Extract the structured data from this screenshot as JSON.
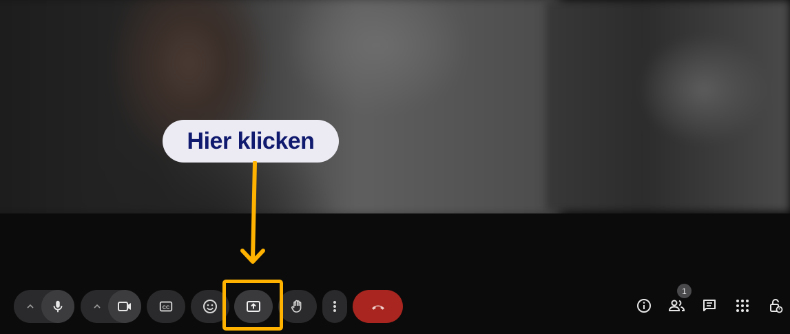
{
  "callout": {
    "text": "Hier klicken"
  },
  "toolbar": {
    "buttons": [
      {
        "name": "mic-options",
        "icon": "chevron-up-icon"
      },
      {
        "name": "microphone",
        "icon": "mic-icon"
      },
      {
        "name": "camera-options",
        "icon": "chevron-up-icon"
      },
      {
        "name": "camera",
        "icon": "video-camera-icon"
      },
      {
        "name": "captions",
        "icon": "closed-captions-icon"
      },
      {
        "name": "reactions",
        "icon": "emoji-icon"
      },
      {
        "name": "present-screen",
        "icon": "present-screen-icon"
      },
      {
        "name": "raise-hand",
        "icon": "hand-icon"
      },
      {
        "name": "more-options",
        "icon": "more-vertical-icon"
      },
      {
        "name": "leave-call",
        "icon": "phone-hangup-icon"
      }
    ]
  },
  "side_controls": {
    "participants_count": "1",
    "icons": [
      "info-icon",
      "people-icon",
      "chat-icon",
      "apps-grid-icon",
      "host-controls-lock-icon"
    ]
  },
  "colors": {
    "highlight": "#ffb300",
    "arrow": "#ffb300",
    "callout_bg": "#ecebf3",
    "callout_text": "#101a6e",
    "hangup": "#a8261f"
  }
}
